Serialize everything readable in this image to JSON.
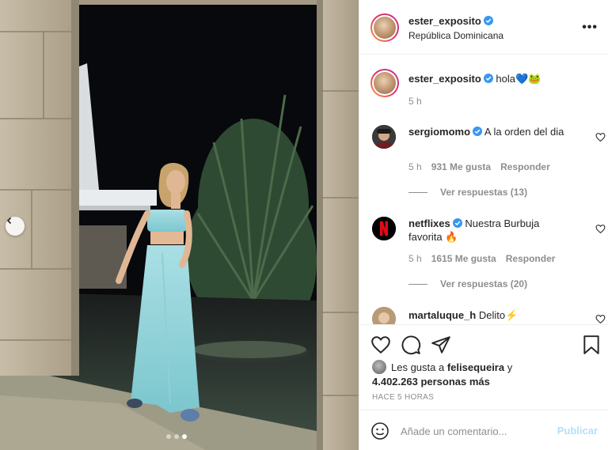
{
  "post": {
    "author": "ester_exposito",
    "location": "República Dominicana",
    "more_icon": "more-dots-icon",
    "carousel_dots": 3,
    "active_dot": 2
  },
  "caption": {
    "username": "ester_exposito",
    "text": "hola💙🐸",
    "time": "5 h"
  },
  "comments": [
    {
      "username": "sergiomomo",
      "text": "A la orden del dia",
      "time": "5 h",
      "likes": "931 Me gusta",
      "reply": "Responder",
      "replies": "Ver respuestas (13)"
    },
    {
      "username": "netflixes",
      "text": "Nuestra Burbuja favorita 🔥",
      "time": "5 h",
      "likes": "1615 Me gusta",
      "reply": "Responder",
      "replies": "Ver respuestas (20)"
    },
    {
      "username": "martaluque_h",
      "text": "Delito⚡"
    }
  ],
  "likes": {
    "prefix": "Les gusta a",
    "first": "felisequeira",
    "middle": "y",
    "count": "4.402.263 personas más"
  },
  "timestamp": "HACE 5 HORAS",
  "comment_box": {
    "placeholder": "Añade un comentario...",
    "publish": "Publicar"
  },
  "colors": {
    "verified": "#3897f0",
    "publish_disabled": "#b2dffc",
    "netflix_red": "#e50914"
  }
}
